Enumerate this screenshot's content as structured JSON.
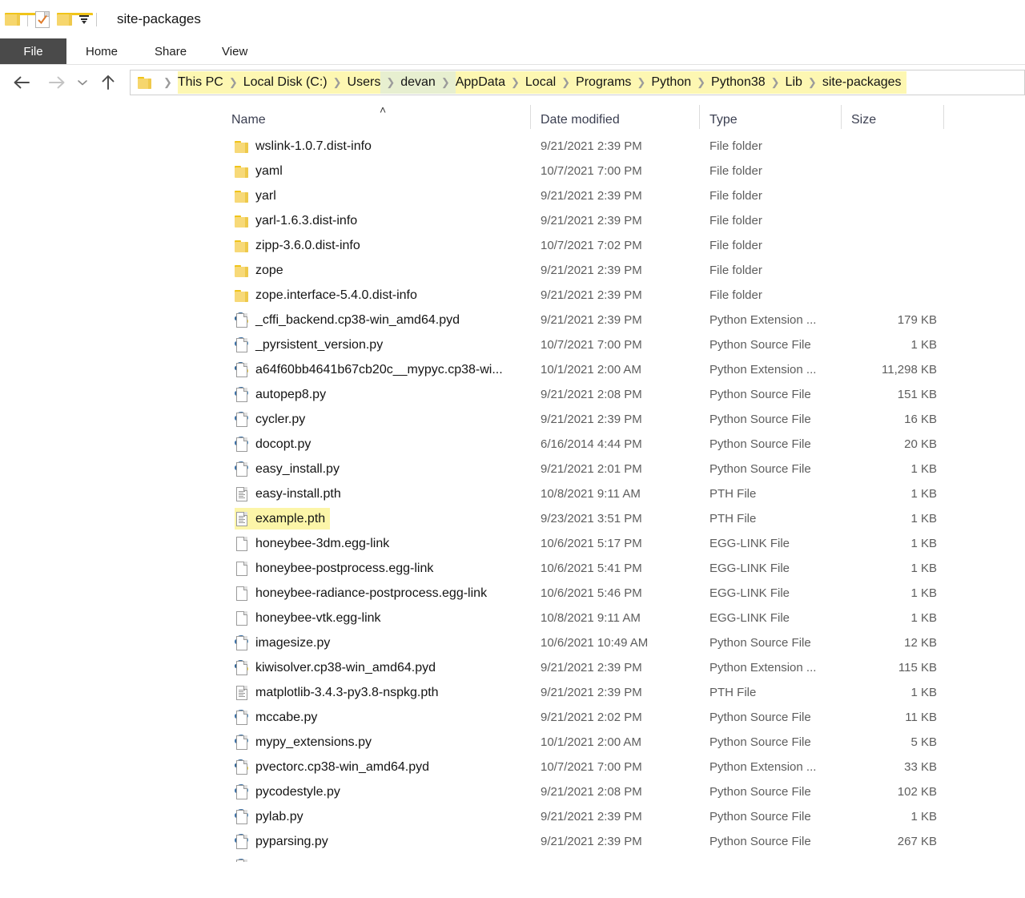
{
  "window": {
    "title": "site-packages",
    "quick_access": [
      "folder-icon",
      "document-check-icon",
      "folder-icon",
      "dropdown-icon"
    ]
  },
  "ribbon": {
    "tabs": [
      {
        "label": "File",
        "active": true
      },
      {
        "label": "Home",
        "active": false
      },
      {
        "label": "Share",
        "active": false
      },
      {
        "label": "View",
        "active": false
      }
    ]
  },
  "navigation": {
    "back": "back-arrow",
    "forward": "forward-arrow",
    "recent": "chevron-down",
    "up": "up-arrow"
  },
  "breadcrumb": {
    "segments": [
      {
        "label": "This PC",
        "highlight": "yellow"
      },
      {
        "label": "Local Disk (C:)",
        "highlight": "yellow"
      },
      {
        "label": "Users",
        "highlight": "yellow"
      },
      {
        "label": "devan",
        "highlight": "green"
      },
      {
        "label": "AppData",
        "highlight": "yellow"
      },
      {
        "label": "Local",
        "highlight": "yellow"
      },
      {
        "label": "Programs",
        "highlight": "yellow"
      },
      {
        "label": "Python",
        "highlight": "yellow"
      },
      {
        "label": "Python38",
        "highlight": "yellow"
      },
      {
        "label": "Lib",
        "highlight": "yellow"
      },
      {
        "label": "site-packages",
        "highlight": "yellow"
      }
    ]
  },
  "columns": {
    "name": "Name",
    "date_modified": "Date modified",
    "type": "Type",
    "size": "Size",
    "sort_indicator": "˄"
  },
  "colors": {
    "highlight_yellow": "#fdf7b2",
    "highlight_green": "#e7efd0",
    "selection_yellow": "#fcf5a8",
    "file_tab_bg": "#4a4a4a",
    "folder_gold": "#f7d978"
  },
  "files": [
    {
      "name": "wslink-1.0.7.dist-info",
      "date": "9/21/2021 2:39 PM",
      "type": "File folder",
      "size": "",
      "icon": "folder-icon",
      "selected": false
    },
    {
      "name": "yaml",
      "date": "10/7/2021 7:00 PM",
      "type": "File folder",
      "size": "",
      "icon": "folder-icon",
      "selected": false
    },
    {
      "name": "yarl",
      "date": "9/21/2021 2:39 PM",
      "type": "File folder",
      "size": "",
      "icon": "folder-icon",
      "selected": false
    },
    {
      "name": "yarl-1.6.3.dist-info",
      "date": "9/21/2021 2:39 PM",
      "type": "File folder",
      "size": "",
      "icon": "folder-icon",
      "selected": false
    },
    {
      "name": "zipp-3.6.0.dist-info",
      "date": "10/7/2021 7:02 PM",
      "type": "File folder",
      "size": "",
      "icon": "folder-icon",
      "selected": false
    },
    {
      "name": "zope",
      "date": "9/21/2021 2:39 PM",
      "type": "File folder",
      "size": "",
      "icon": "folder-icon",
      "selected": false
    },
    {
      "name": "zope.interface-5.4.0.dist-info",
      "date": "9/21/2021 2:39 PM",
      "type": "File folder",
      "size": "",
      "icon": "folder-icon",
      "selected": false
    },
    {
      "name": "_cffi_backend.cp38-win_amd64.pyd",
      "date": "9/21/2021 2:39 PM",
      "type": "Python Extension ...",
      "size": "179 KB",
      "icon": "python-extension-icon",
      "selected": false
    },
    {
      "name": "_pyrsistent_version.py",
      "date": "10/7/2021 7:00 PM",
      "type": "Python Source File",
      "size": "1 KB",
      "icon": "python-source-icon",
      "selected": false
    },
    {
      "name": "a64f60bb4641b67cb20c__mypyc.cp38-wi...",
      "date": "10/1/2021 2:00 AM",
      "type": "Python Extension ...",
      "size": "11,298 KB",
      "icon": "python-extension-icon",
      "selected": false
    },
    {
      "name": "autopep8.py",
      "date": "9/21/2021 2:08 PM",
      "type": "Python Source File",
      "size": "151 KB",
      "icon": "python-source-icon",
      "selected": false
    },
    {
      "name": "cycler.py",
      "date": "9/21/2021 2:39 PM",
      "type": "Python Source File",
      "size": "16 KB",
      "icon": "python-source-icon",
      "selected": false
    },
    {
      "name": "docopt.py",
      "date": "6/16/2014 4:44 PM",
      "type": "Python Source File",
      "size": "20 KB",
      "icon": "python-source-icon",
      "selected": false
    },
    {
      "name": "easy_install.py",
      "date": "9/21/2021 2:01 PM",
      "type": "Python Source File",
      "size": "1 KB",
      "icon": "python-source-icon",
      "selected": false
    },
    {
      "name": "easy-install.pth",
      "date": "10/8/2021 9:11 AM",
      "type": "PTH File",
      "size": "1 KB",
      "icon": "pth-file-icon",
      "selected": false
    },
    {
      "name": "example.pth",
      "date": "9/23/2021 3:51 PM",
      "type": "PTH File",
      "size": "1 KB",
      "icon": "pth-file-icon",
      "selected": true
    },
    {
      "name": "honeybee-3dm.egg-link",
      "date": "10/6/2021 5:17 PM",
      "type": "EGG-LINK File",
      "size": "1 KB",
      "icon": "blank-file-icon",
      "selected": false
    },
    {
      "name": "honeybee-postprocess.egg-link",
      "date": "10/6/2021 5:41 PM",
      "type": "EGG-LINK File",
      "size": "1 KB",
      "icon": "blank-file-icon",
      "selected": false
    },
    {
      "name": "honeybee-radiance-postprocess.egg-link",
      "date": "10/6/2021 5:46 PM",
      "type": "EGG-LINK File",
      "size": "1 KB",
      "icon": "blank-file-icon",
      "selected": false
    },
    {
      "name": "honeybee-vtk.egg-link",
      "date": "10/8/2021 9:11 AM",
      "type": "EGG-LINK File",
      "size": "1 KB",
      "icon": "blank-file-icon",
      "selected": false
    },
    {
      "name": "imagesize.py",
      "date": "10/6/2021 10:49 AM",
      "type": "Python Source File",
      "size": "12 KB",
      "icon": "python-source-icon",
      "selected": false
    },
    {
      "name": "kiwisolver.cp38-win_amd64.pyd",
      "date": "9/21/2021 2:39 PM",
      "type": "Python Extension ...",
      "size": "115 KB",
      "icon": "python-extension-icon",
      "selected": false
    },
    {
      "name": "matplotlib-3.4.3-py3.8-nspkg.pth",
      "date": "9/21/2021 2:39 PM",
      "type": "PTH File",
      "size": "1 KB",
      "icon": "pth-file-icon",
      "selected": false
    },
    {
      "name": "mccabe.py",
      "date": "9/21/2021 2:02 PM",
      "type": "Python Source File",
      "size": "11 KB",
      "icon": "python-source-icon",
      "selected": false
    },
    {
      "name": "mypy_extensions.py",
      "date": "10/1/2021 2:00 AM",
      "type": "Python Source File",
      "size": "5 KB",
      "icon": "python-source-icon",
      "selected": false
    },
    {
      "name": "pvectorc.cp38-win_amd64.pyd",
      "date": "10/7/2021 7:00 PM",
      "type": "Python Extension ...",
      "size": "33 KB",
      "icon": "python-extension-icon",
      "selected": false
    },
    {
      "name": "pycodestyle.py",
      "date": "9/21/2021 2:08 PM",
      "type": "Python Source File",
      "size": "102 KB",
      "icon": "python-source-icon",
      "selected": false
    },
    {
      "name": "pylab.py",
      "date": "9/21/2021 2:39 PM",
      "type": "Python Source File",
      "size": "1 KB",
      "icon": "python-source-icon",
      "selected": false
    },
    {
      "name": "pyparsing.py",
      "date": "9/21/2021 2:39 PM",
      "type": "Python Source File",
      "size": "267 KB",
      "icon": "python-source-icon",
      "selected": false
    }
  ]
}
